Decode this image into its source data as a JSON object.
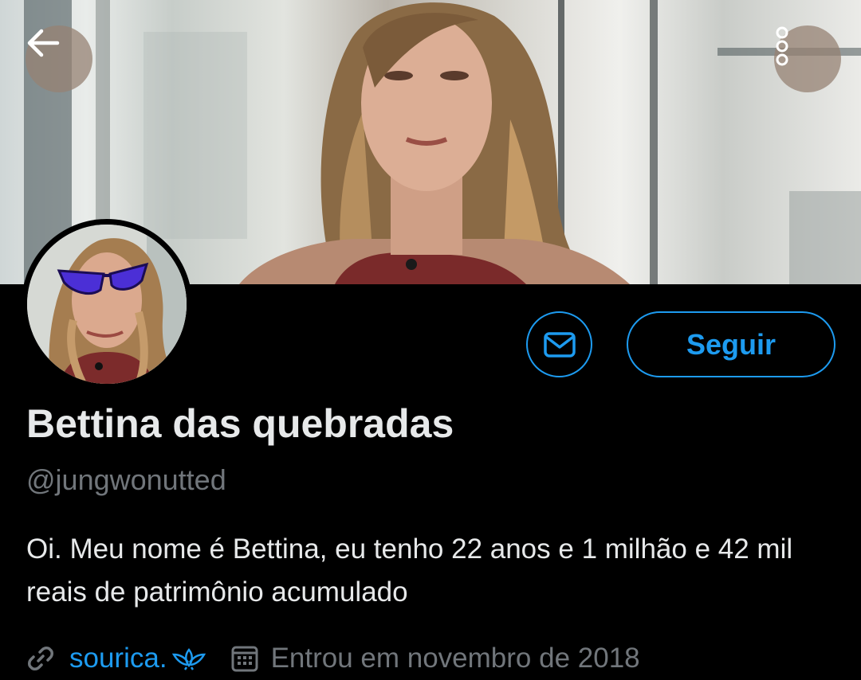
{
  "header": {
    "back_icon": "arrow-left-icon",
    "more_icon": "more-vertical-icon"
  },
  "actions": {
    "message_icon": "envelope-icon",
    "follow_label": "Seguir"
  },
  "profile": {
    "display_name": "Bettina das quebradas",
    "handle": "@jungwonutted",
    "bio": "Oi. Meu nome é Bettina, eu tenho 22 anos e 1 milhão e 42 mil reais de patrimônio acumulado",
    "website": "sourica.",
    "joined": "Entrou em novembro de 2018"
  },
  "colors": {
    "background": "#000000",
    "accent": "#1d9bf0",
    "primary_text": "#e7e9ea",
    "secondary_text": "#71767b"
  }
}
